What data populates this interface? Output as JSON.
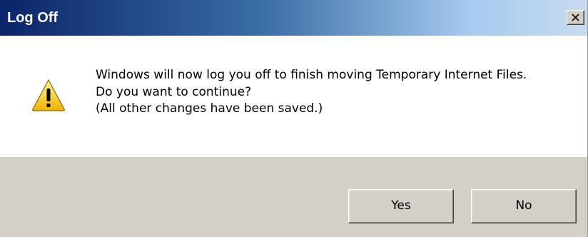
{
  "window": {
    "title": "Log Off",
    "close_icon": "close-icon"
  },
  "message": {
    "icon": "warning-icon",
    "lines": [
      "Windows will now log you off to finish moving Temporary Internet Files.",
      "Do you want to continue?",
      "(All other changes have been saved.)"
    ]
  },
  "buttons": {
    "yes_label": "Yes",
    "no_label": "No"
  },
  "colors": {
    "title_gradient_start": "#0a246a",
    "title_gradient_end": "#c8dbee",
    "footer_bg": "#d4d0c8",
    "warning_yellow": "#f5c400"
  }
}
